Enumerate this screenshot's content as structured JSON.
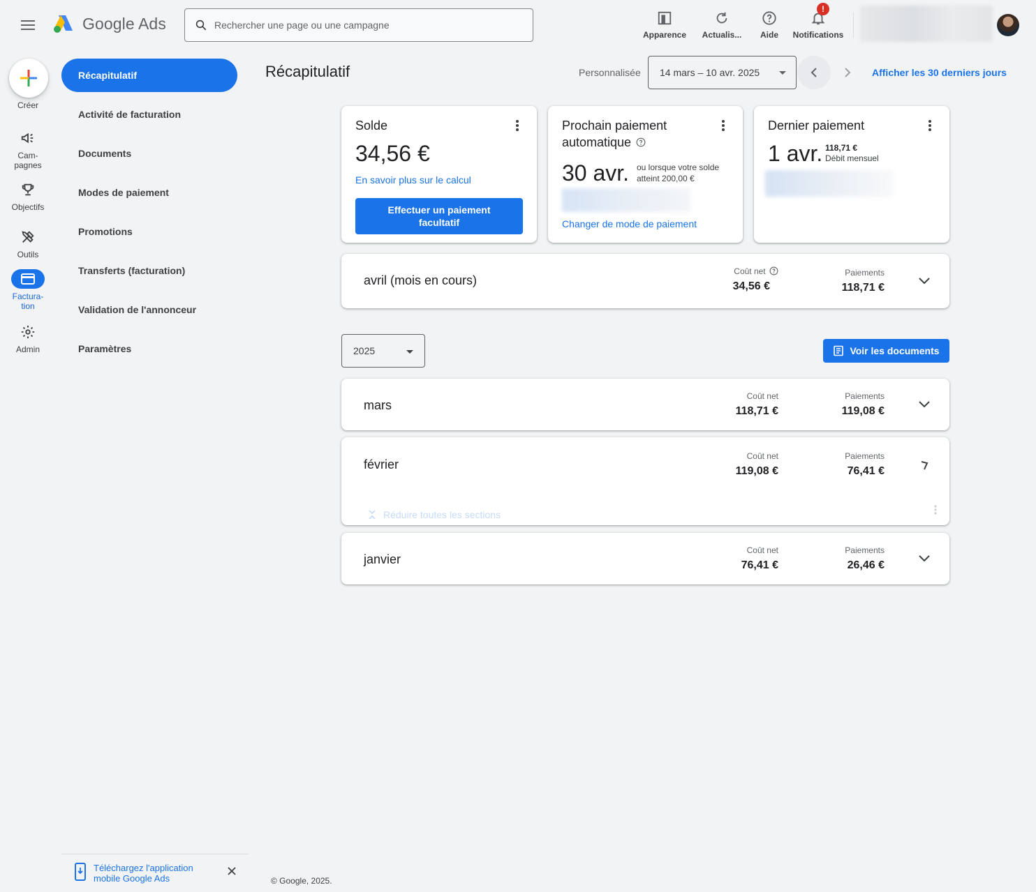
{
  "app": {
    "name": "Google Ads"
  },
  "search": {
    "placeholder": "Rechercher une page ou une campagne"
  },
  "top_actions": [
    {
      "label": "Apparence",
      "icon": "appearance-icon"
    },
    {
      "label": "Actualis...",
      "icon": "refresh-icon"
    },
    {
      "label": "Aide",
      "icon": "help-icon"
    },
    {
      "label": "Notifications",
      "icon": "bell-icon",
      "badge": "!"
    }
  ],
  "rail": {
    "create": "Créer",
    "items": [
      {
        "label": "Cam-\npagnes",
        "icon": "megaphone-icon"
      },
      {
        "label": "Objectifs",
        "icon": "trophy-icon"
      },
      {
        "label": "Outils",
        "icon": "tools-icon"
      },
      {
        "label": "Factura-\ntion",
        "icon": "credit-card-icon",
        "active": true
      },
      {
        "label": "Admin",
        "icon": "gear-icon"
      }
    ]
  },
  "subnav": [
    {
      "label": "Récapitulatif",
      "active": true
    },
    {
      "label": "Activité de facturation"
    },
    {
      "label": "Documents"
    },
    {
      "label": "Modes de paiement"
    },
    {
      "label": "Promotions"
    },
    {
      "label": "Transferts (facturation)"
    },
    {
      "label": "Validation de l'annonceur"
    },
    {
      "label": "Paramètres"
    }
  ],
  "header": {
    "title": "Récapitulatif",
    "date_label": "Personnalisée",
    "date_range": "14 mars – 10 avr. 2025",
    "last30": "Afficher les 30 derniers jours"
  },
  "cards": {
    "solde": {
      "title": "Solde",
      "amount": "34,56 €",
      "link": "En savoir plus sur le calcul",
      "button": "Effectuer un paiement facultatif"
    },
    "next_payment": {
      "title": "Prochain paiement automatique",
      "date": "30 avr.",
      "note": "ou lorsque votre solde atteint 200,00 €",
      "link": "Changer de mode de paiement"
    },
    "last_payment": {
      "title": "Dernier paiement",
      "date": "1 avr.",
      "amount": "118,71 €",
      "type": "Débit mensuel"
    }
  },
  "current_month": {
    "name": "avril (mois en cours)",
    "net_cost_label": "Coût net",
    "net_cost": "34,56 €",
    "payments_label": "Paiements",
    "payments": "118,71 €"
  },
  "year_select": {
    "value": "2025"
  },
  "docs_button": "Voir les documents",
  "months": [
    {
      "name": "mars",
      "net_cost_label": "Coût net",
      "net_cost": "118,71 €",
      "payments_label": "Paiements",
      "payments": "119,08 €"
    },
    {
      "name": "février",
      "net_cost_label": "Coût net",
      "net_cost": "119,08 €",
      "payments_label": "Paiements",
      "payments": "76,41 €"
    },
    {
      "name": "janvier",
      "net_cost_label": "Coût net",
      "net_cost": "76,41 €",
      "payments_label": "Paiements",
      "payments": "26,46 €"
    }
  ],
  "collapse_all": "Réduire toutes les sections",
  "footer": {
    "app_promo": "Téléchargez l'application mobile Google Ads",
    "copyright": "© Google, 2025."
  },
  "colors": {
    "accent": "#1a73e8",
    "badge": "#d93025",
    "background": "#f1f3f4"
  }
}
